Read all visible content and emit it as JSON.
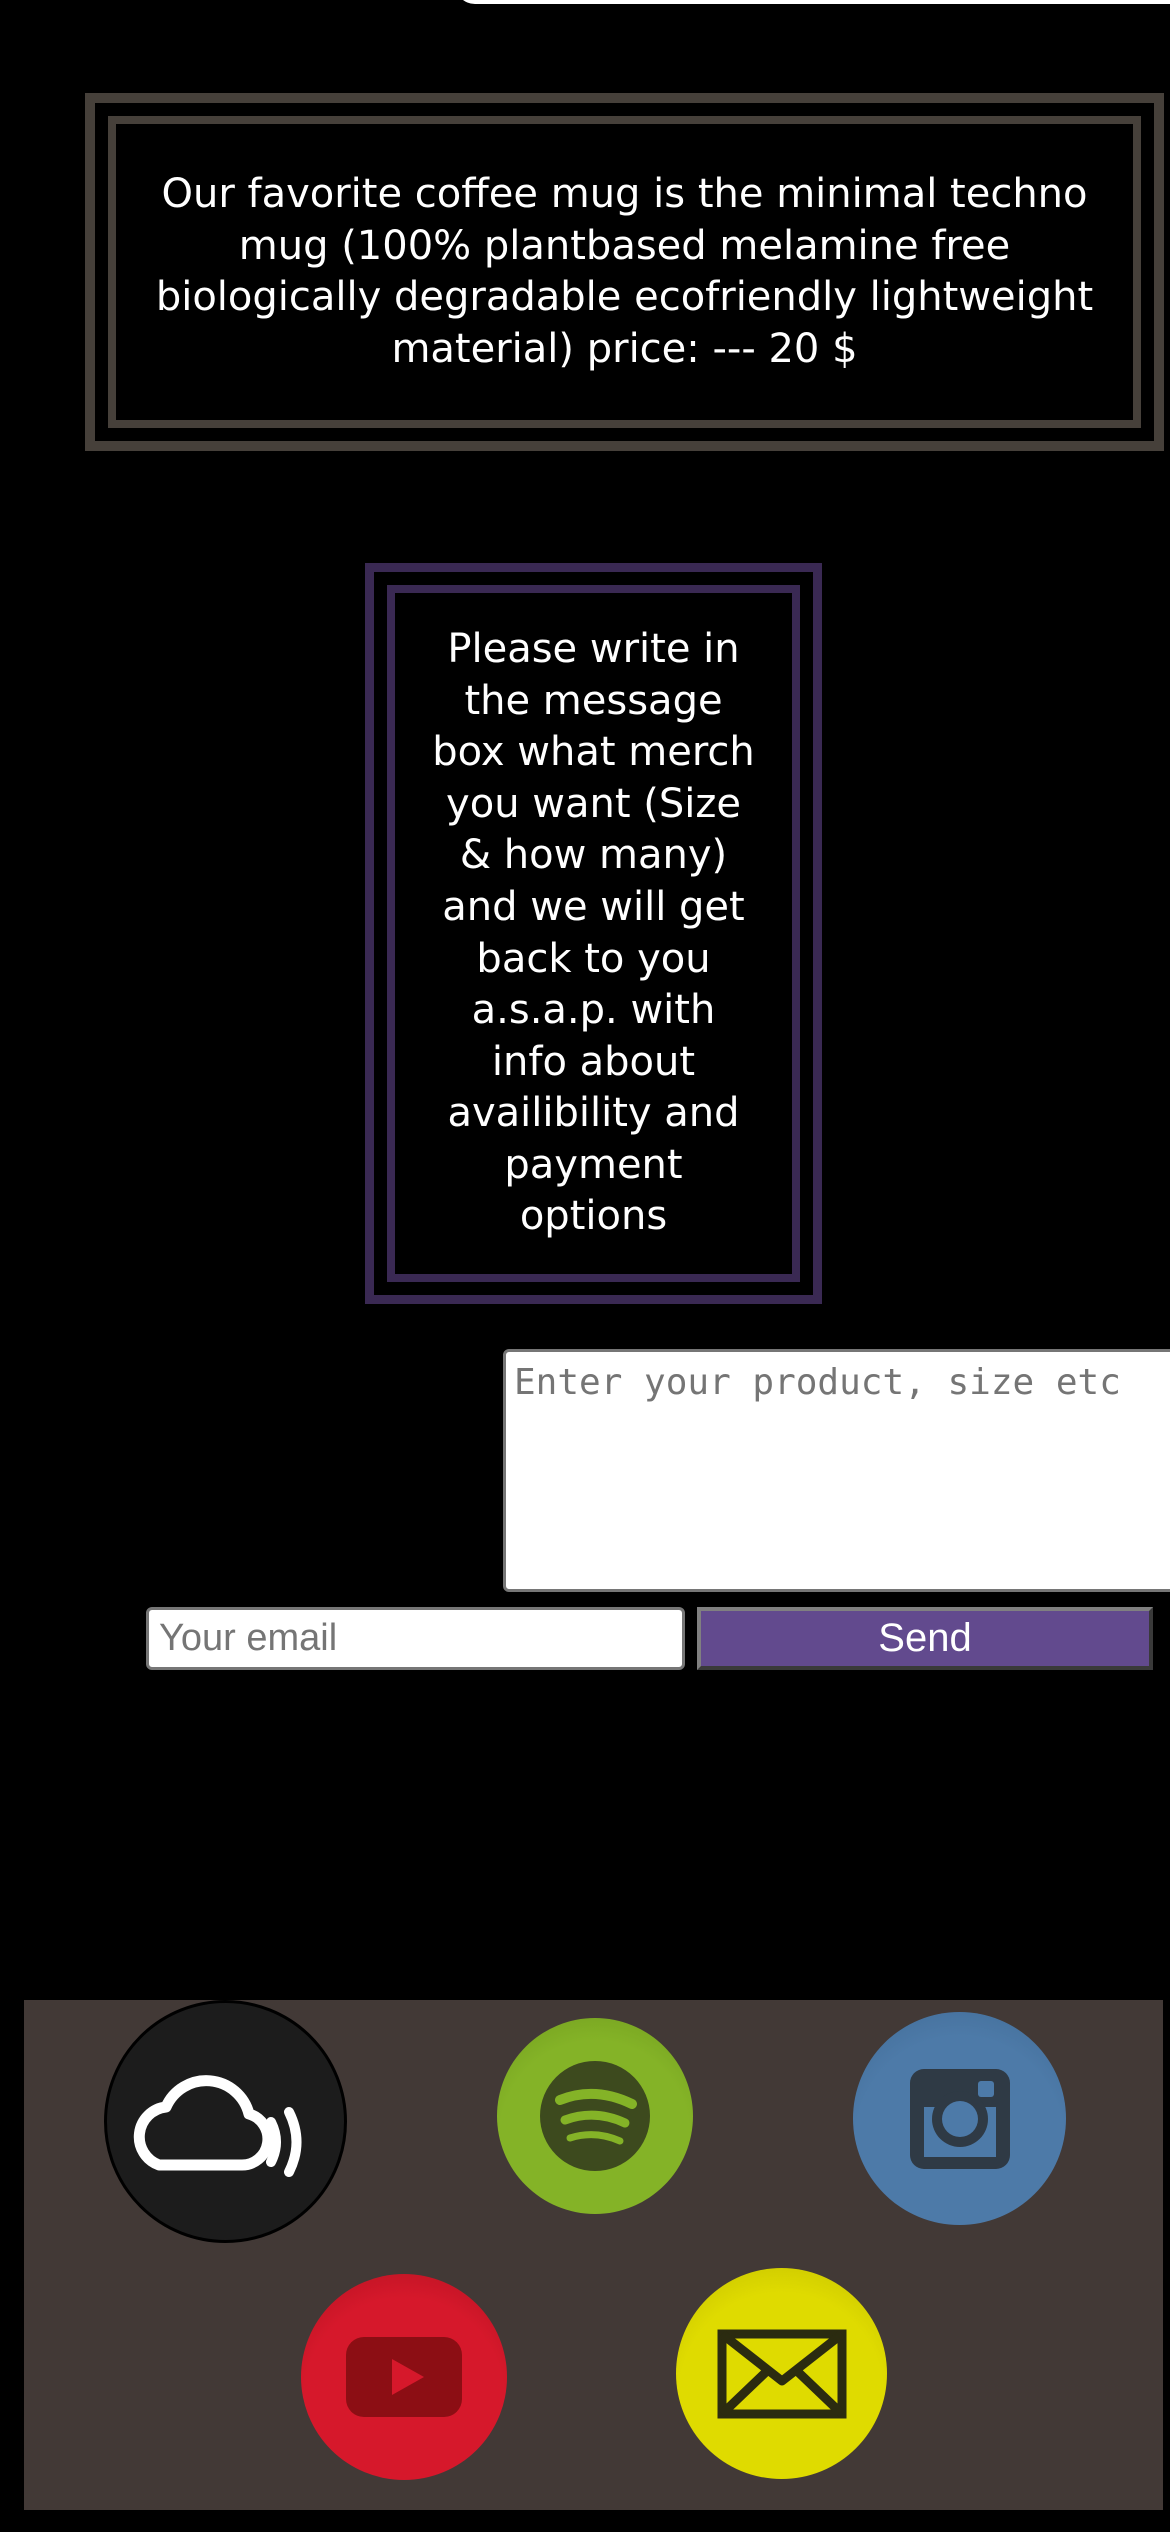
{
  "merch": {
    "mug_text": "Our favorite coffee mug is the minimal techno mug (100% plantbased melamine free biologically degradable ecofriendly lightweight material) price: --- 20 $"
  },
  "instructions": {
    "text": "Please write in the message box what merch you want (Size & how many) and we will get back to you a.s.a.p. with info about availibility and payment options"
  },
  "form": {
    "product_placeholder": "Enter your product, size etc",
    "product_value": "",
    "email_placeholder": "Your email",
    "email_value": "",
    "send_label": "Send"
  },
  "colors": {
    "page_background": "#000000",
    "mug_frame": "#46403a",
    "instructions_frame": "#3a2953",
    "send_button": "#624a8e",
    "footer_background": "#423936",
    "mixcloud": "#1c1c1c",
    "spotify": "#84b327",
    "instagram": "#4d7aa8",
    "youtube": "#d6182b",
    "email": "#dfdb00"
  },
  "social_links": [
    {
      "icon": "mixcloud-icon"
    },
    {
      "icon": "spotify-icon"
    },
    {
      "icon": "instagram-icon"
    },
    {
      "icon": "youtube-icon"
    },
    {
      "icon": "email-icon"
    }
  ]
}
